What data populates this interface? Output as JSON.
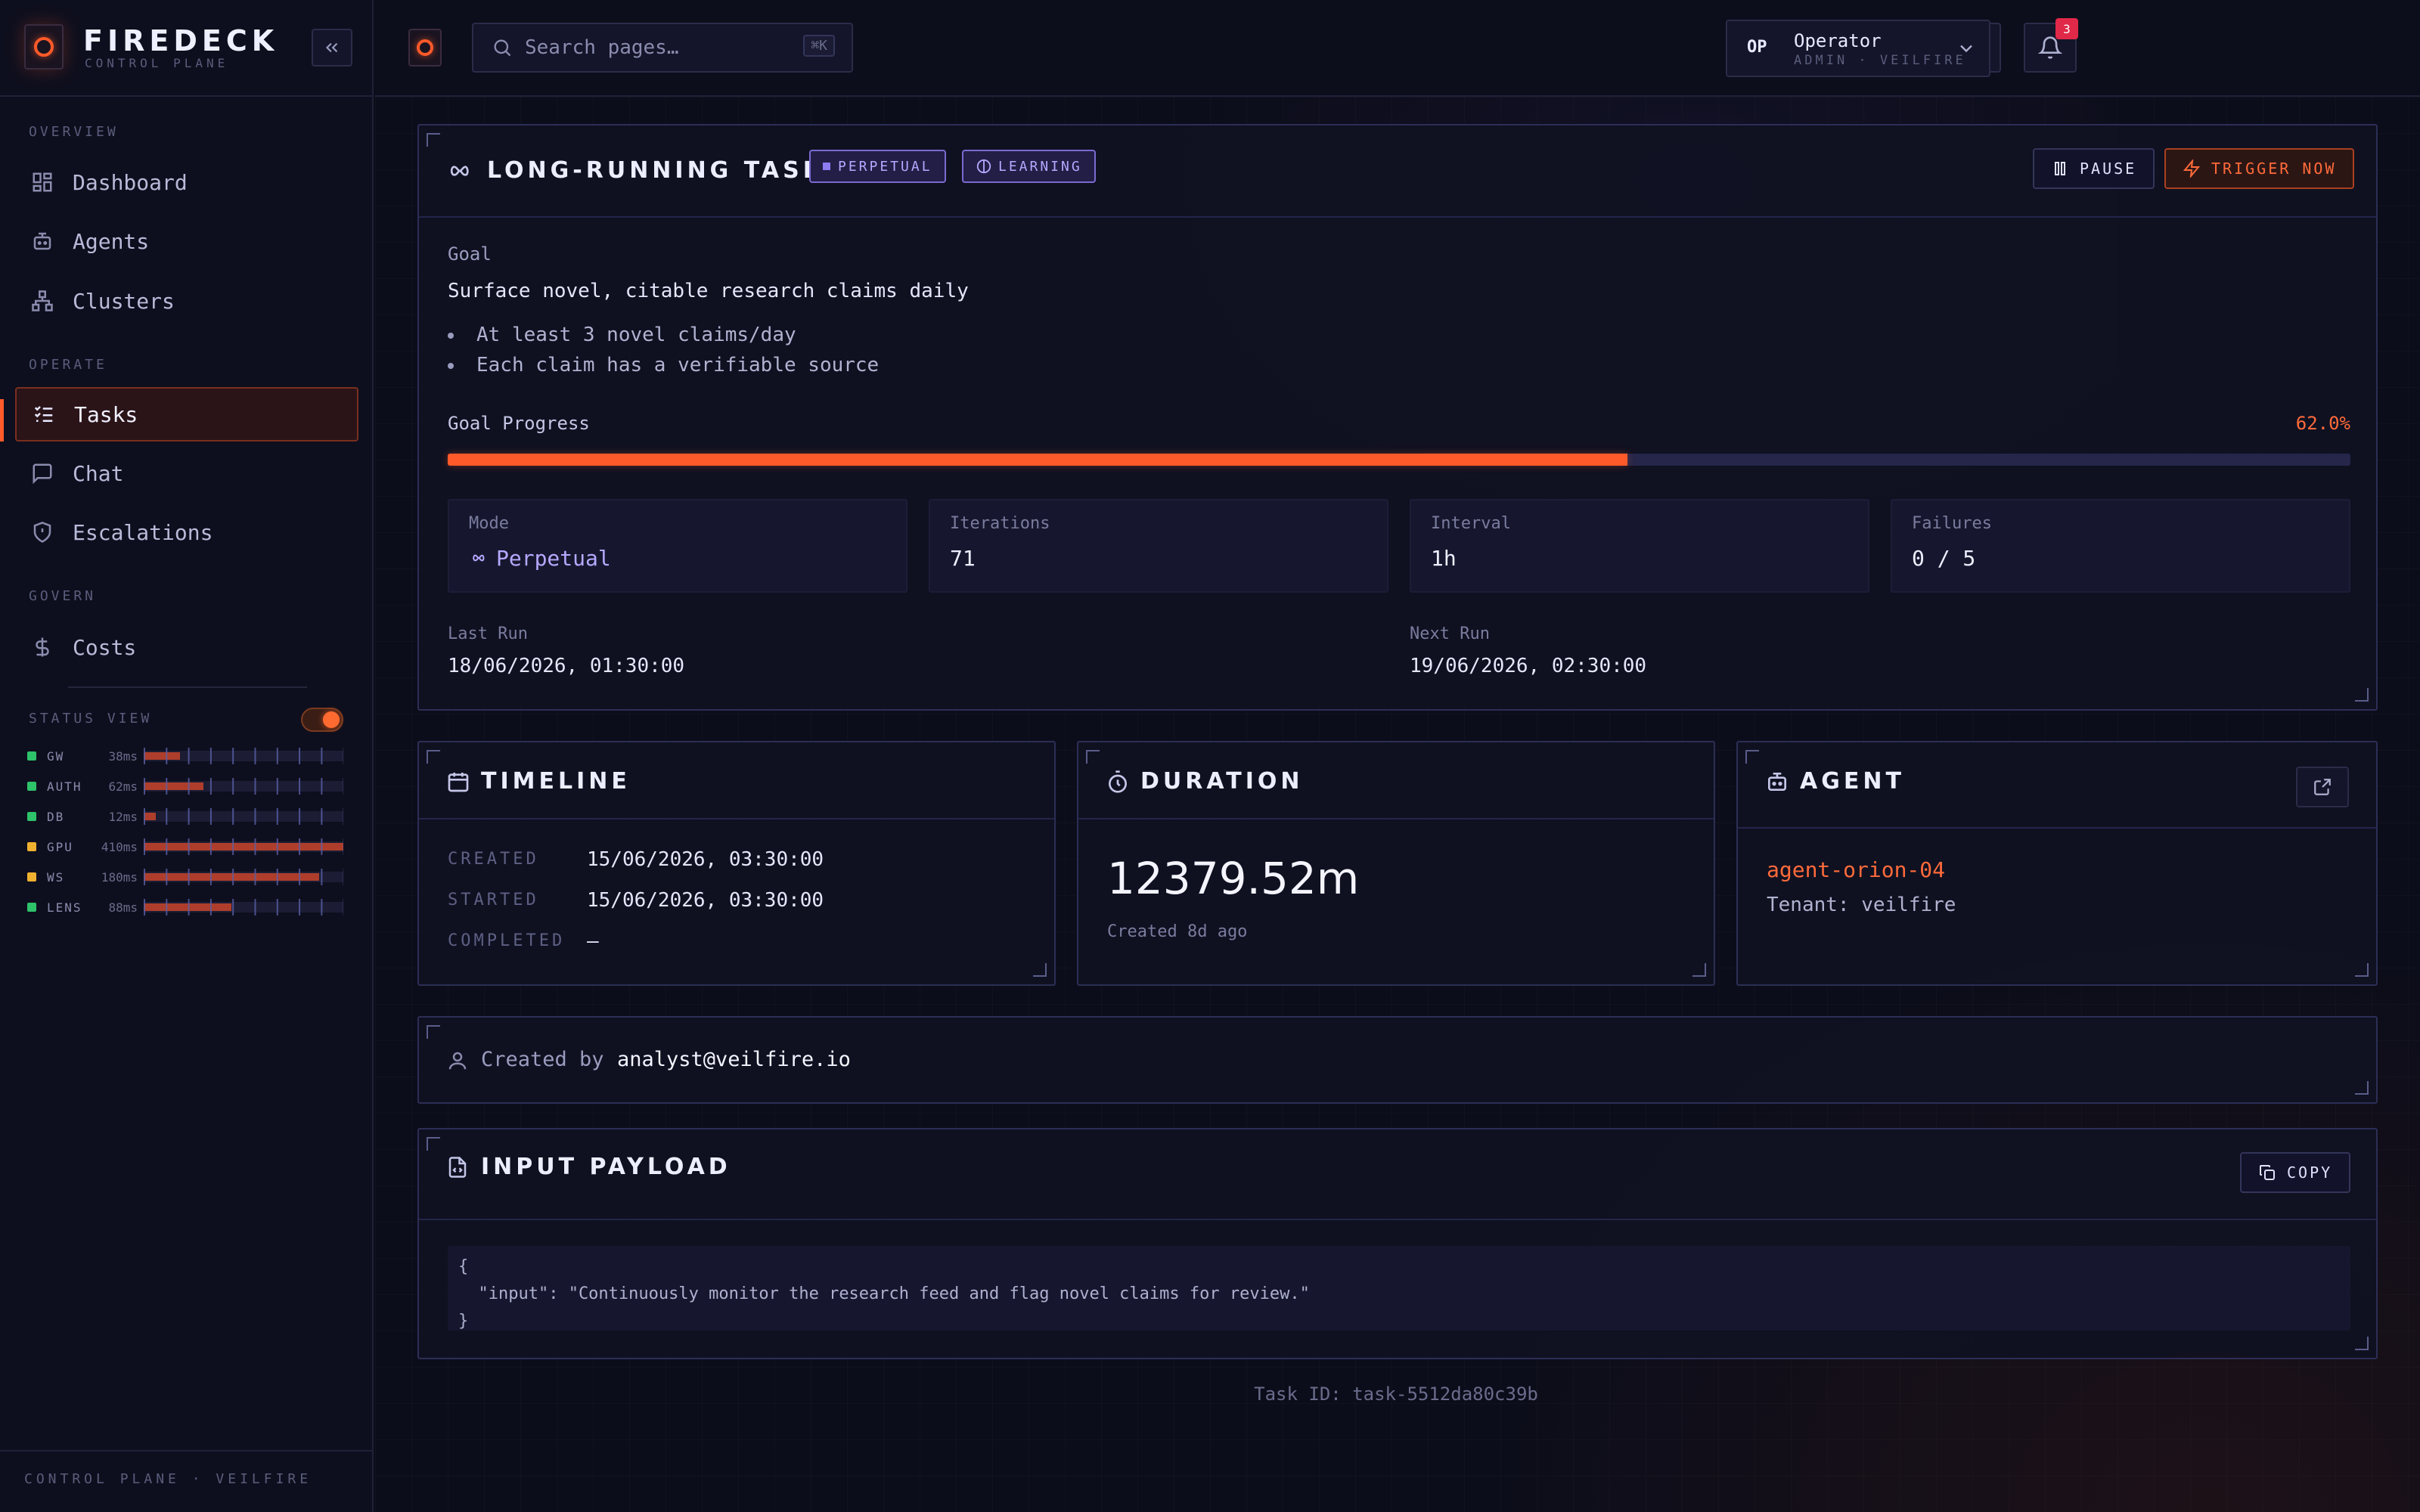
{
  "brand": {
    "name": "FIREDECK",
    "sub": "CONTROL PLANE",
    "footer": "CONTROL PLANE · VEILFIRE"
  },
  "nav": {
    "sections": [
      {
        "label": "OVERVIEW",
        "items": [
          {
            "label": "Dashboard",
            "icon": "dashboard-icon"
          },
          {
            "label": "Agents",
            "icon": "robot-icon"
          },
          {
            "label": "Clusters",
            "icon": "cluster-icon"
          }
        ]
      },
      {
        "label": "OPERATE",
        "items": [
          {
            "label": "Tasks",
            "icon": "tasks-icon",
            "active": true
          },
          {
            "label": "Chat",
            "icon": "chat-icon"
          },
          {
            "label": "Escalations",
            "icon": "shield-icon"
          }
        ]
      },
      {
        "label": "GOVERN",
        "items": [
          {
            "label": "Costs",
            "icon": "dollar-icon"
          }
        ]
      }
    ]
  },
  "status_view": {
    "label": "STATUS VIEW",
    "enabled": true,
    "services": [
      {
        "name": "GW",
        "latency": "38ms",
        "status": "ok",
        "load": 0.18
      },
      {
        "name": "AUTH",
        "latency": "62ms",
        "status": "ok",
        "load": 0.3
      },
      {
        "name": "DB",
        "latency": "12ms",
        "status": "ok",
        "load": 0.06
      },
      {
        "name": "GPU",
        "latency": "410ms",
        "status": "warn",
        "load": 1.0
      },
      {
        "name": "WS",
        "latency": "180ms",
        "status": "warn",
        "load": 0.88
      },
      {
        "name": "LENS",
        "latency": "88ms",
        "status": "ok",
        "load": 0.44
      }
    ],
    "colors": {
      "ok": "#2ec26a",
      "warn": "#f0b030"
    }
  },
  "topbar": {
    "search_placeholder": "Search pages…",
    "search_kbd": "⌘K",
    "notif_count": "3",
    "user": {
      "initials": "OP",
      "name": "Operator",
      "role": "ADMIN · VEILFIRE"
    }
  },
  "task": {
    "title": "LONG-RUNNING TASK",
    "badges": [
      "PERPETUAL",
      "LEARNING"
    ],
    "pause_label": "PAUSE",
    "trigger_label": "TRIGGER NOW",
    "goal_label": "Goal",
    "goal": "Surface novel, citable research claims daily",
    "criteria": [
      "At least 3 novel claims/day",
      "Each claim has a verifiable source"
    ],
    "progress_label": "Goal Progress",
    "progress_text": "62.0%",
    "progress": 0.62,
    "stats": [
      {
        "label": "Mode",
        "value": "Perpetual"
      },
      {
        "label": "Iterations",
        "value": "71"
      },
      {
        "label": "Interval",
        "value": "1h"
      },
      {
        "label": "Failures",
        "value": "0 / 5"
      }
    ],
    "last_run_label": "Last Run",
    "last_run": "18/06/2026, 01:30:00",
    "next_run_label": "Next Run",
    "next_run": "19/06/2026, 02:30:00"
  },
  "timeline": {
    "title": "TIMELINE",
    "rows": [
      {
        "label": "CREATED",
        "value": "15/06/2026, 03:30:00"
      },
      {
        "label": "STARTED",
        "value": "15/06/2026, 03:30:00"
      },
      {
        "label": "COMPLETED",
        "value": "—"
      }
    ]
  },
  "duration": {
    "title": "DURATION",
    "value": "12379.52m",
    "sub": "Created 8d ago"
  },
  "agent": {
    "title": "AGENT",
    "name": "agent-orion-04",
    "tenant": "Tenant: veilfire"
  },
  "creator": {
    "prefix": "Created by",
    "email": "analyst@veilfire.io"
  },
  "payload": {
    "title": "INPUT PAYLOAD",
    "copy_label": "COPY",
    "code": "{\n  \"input\": \"Continuously monitor the research feed and flag novel claims for review.\"\n}"
  },
  "task_id": "Task ID: task-5512da80c39b",
  "colors": {
    "accent": "#ff5a2a",
    "purple": "#b6a8ff",
    "badge": "#e02848"
  }
}
